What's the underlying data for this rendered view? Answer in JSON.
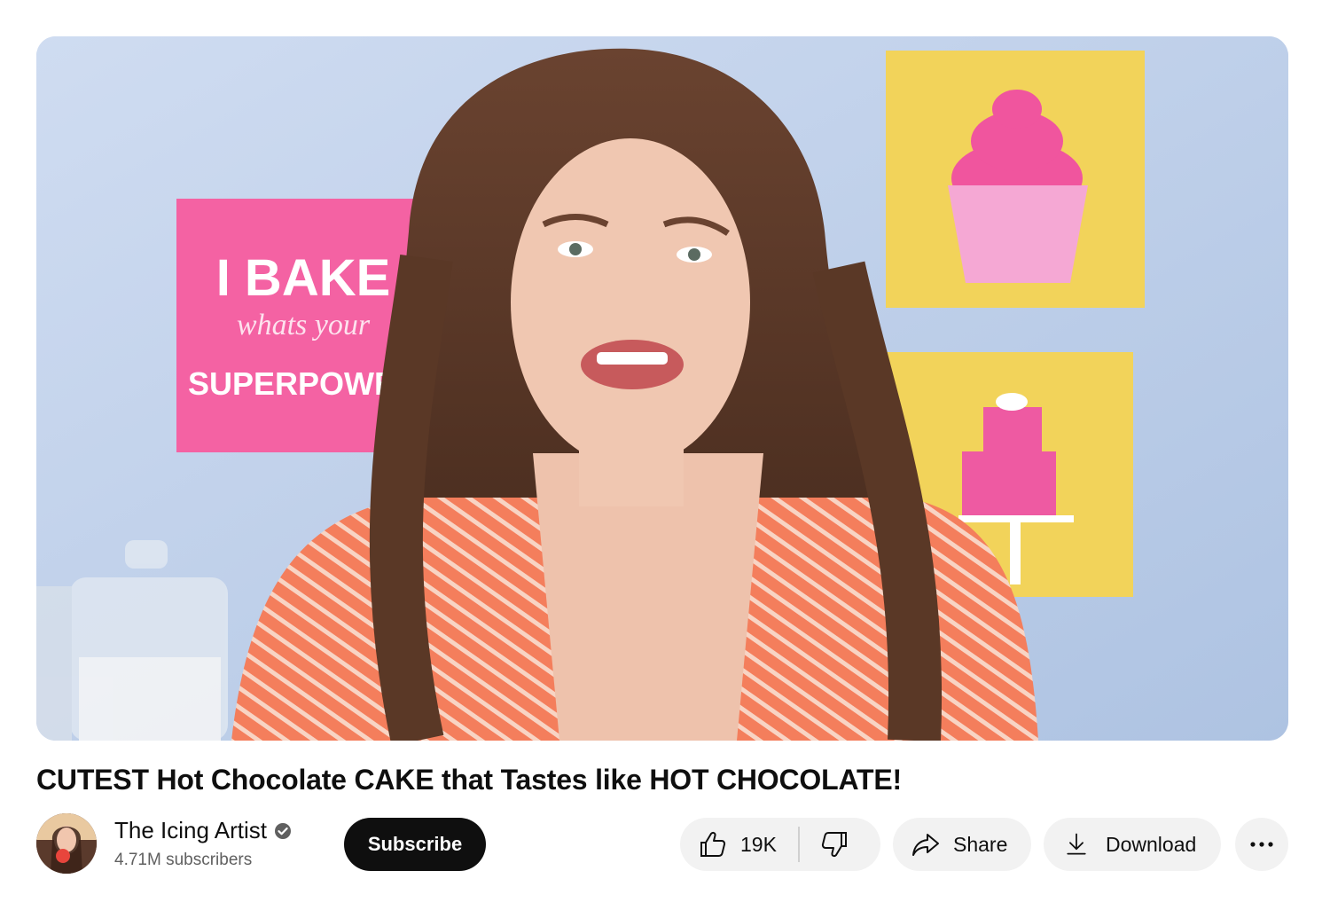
{
  "video": {
    "title": "CUTEST Hot Chocolate CAKE that Tastes like HOT CHOCOLATE!",
    "thumbnail_sign": {
      "line1": "I BAKE",
      "line2": "whats your",
      "line3": "SUPERPOWER"
    }
  },
  "channel": {
    "name": "The Icing Artist",
    "subscribers": "4.71M subscribers",
    "verified_icon": "verified-check-icon"
  },
  "actions": {
    "subscribe_label": "Subscribe",
    "like_count": "19K",
    "share_label": "Share",
    "download_label": "Download",
    "icons": [
      "thumbs-up-icon",
      "thumbs-down-icon",
      "share-arrow-icon",
      "download-icon",
      "more-dots-icon"
    ]
  },
  "colors": {
    "subscribe_bg": "#0f0f0f",
    "pill_bg": "#f2f2f2",
    "secondary_text": "#606060"
  }
}
